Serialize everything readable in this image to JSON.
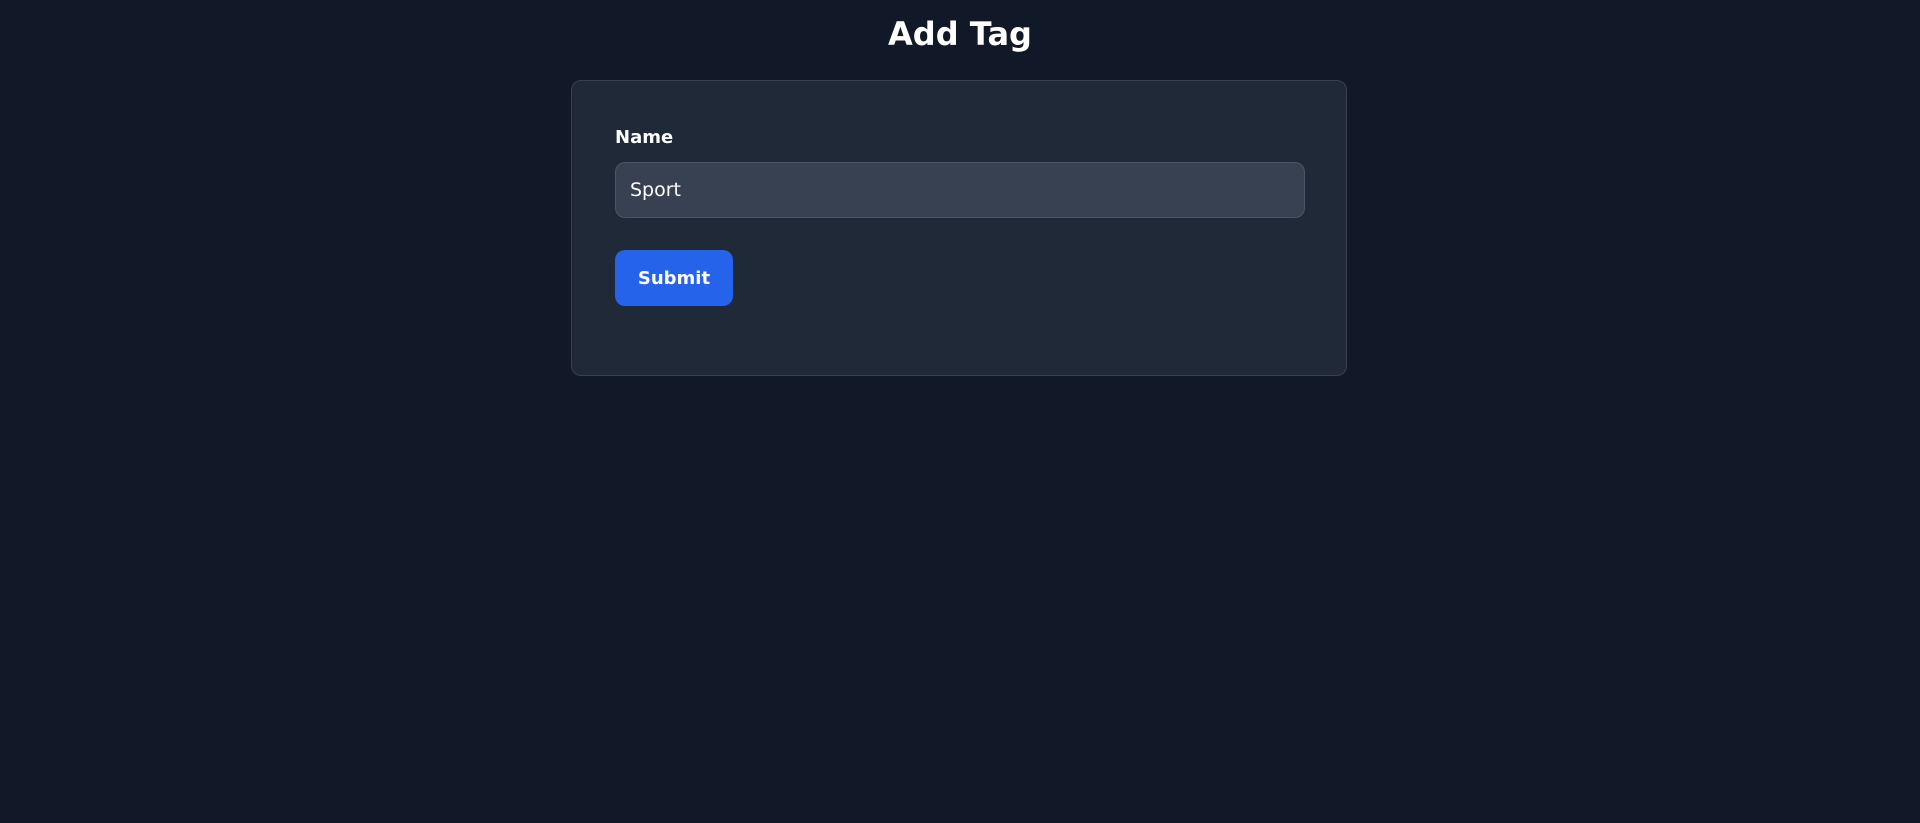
{
  "page": {
    "title": "Add Tag"
  },
  "form": {
    "name_label": "Name",
    "name_value": "Sport",
    "submit_label": "Submit"
  },
  "colors": {
    "background": "#111827",
    "card": "#1f2937",
    "input": "#374151",
    "accent": "#2563eb",
    "text": "#ffffff"
  }
}
